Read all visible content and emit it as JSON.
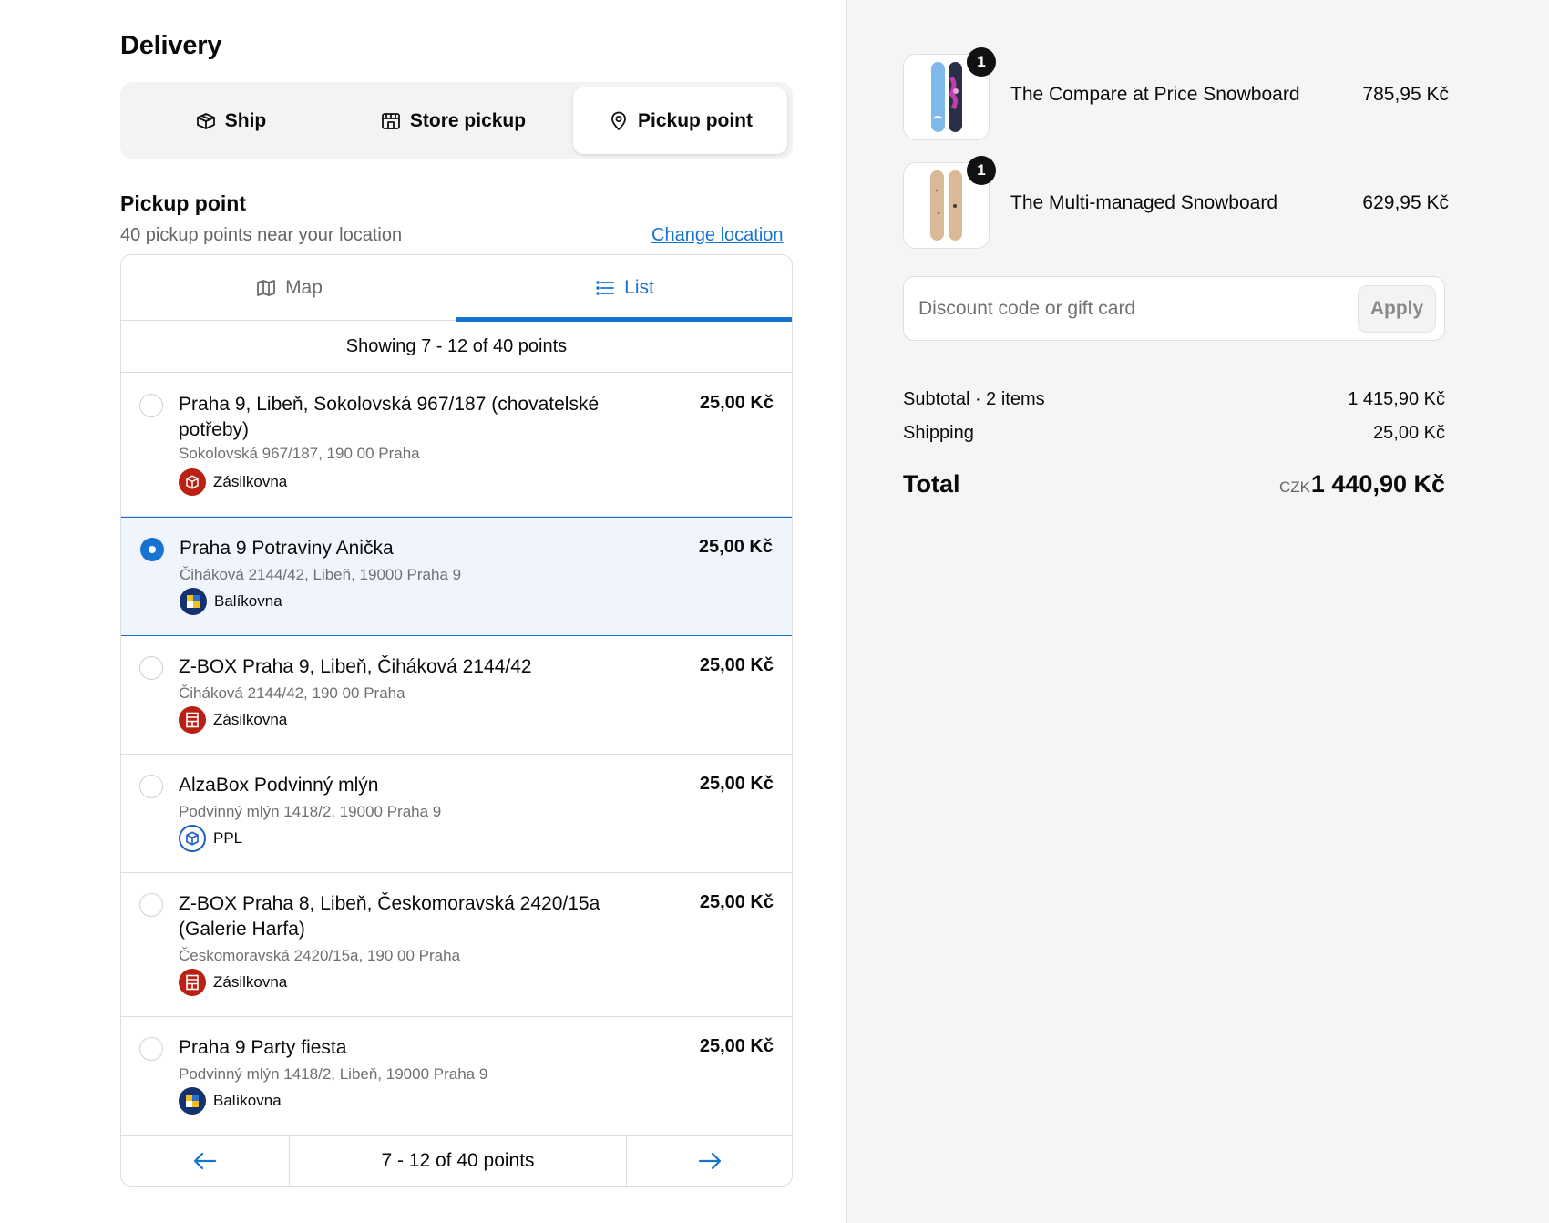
{
  "delivery": {
    "title": "Delivery",
    "methods": [
      {
        "label": "Ship"
      },
      {
        "label": "Store pickup"
      },
      {
        "label": "Pickup point"
      }
    ]
  },
  "pickup": {
    "title": "Pickup point",
    "near": "40 pickup points near your location",
    "change_location": "Change location",
    "tabs": {
      "map": "Map",
      "list": "List"
    },
    "showing": "Showing 7 - 12 of 40 points",
    "points": [
      {
        "name": "Praha 9, Libeň, Sokolovská 967/187 (chovatelské potřeby)",
        "address": "Sokolovská 967/187, 190 00 Praha",
        "carrier": "Zásilkovna",
        "price": "25,00 Kč"
      },
      {
        "name": "Praha 9 Potraviny Anička",
        "address": "Čiháková 2144/42, Libeň, 19000 Praha 9",
        "carrier": "Balíkovna",
        "price": "25,00 Kč"
      },
      {
        "name": "Z-BOX Praha 9, Libeň, Čiháková 2144/42",
        "address": "Čiháková 2144/42, 190 00 Praha",
        "carrier": "Zásilkovna",
        "price": "25,00 Kč"
      },
      {
        "name": "AlzaBox Podvinný mlýn",
        "address": "Podvinný mlýn 1418/2, 19000 Praha 9",
        "carrier": "PPL",
        "price": "25,00 Kč"
      },
      {
        "name": "Z-BOX Praha 8, Libeň, Českomoravská 2420/15a (Galerie Harfa)",
        "address": "Českomoravská 2420/15a, 190 00 Praha",
        "carrier": "Zásilkovna",
        "price": "25,00 Kč"
      },
      {
        "name": "Praha 9 Party fiesta",
        "address": "Podvinný mlýn 1418/2, Libeň, 19000 Praha 9",
        "carrier": "Balíkovna",
        "price": "25,00 Kč"
      }
    ],
    "pager_text": "7 - 12 of 40 points"
  },
  "summary": {
    "items": [
      {
        "title": "The Compare at Price Snowboard",
        "price": "785,95 Kč",
        "qty": "1"
      },
      {
        "title": "The Multi-managed Snowboard",
        "price": "629,95 Kč",
        "qty": "1"
      }
    ],
    "discount_placeholder": "Discount code or gift card",
    "apply_label": "Apply",
    "subtotal_label": "Subtotal · 2 items",
    "subtotal_value": "1 415,90 Kč",
    "shipping_label": "Shipping",
    "shipping_value": "25,00 Kč",
    "total_label": "Total",
    "total_currency": "CZK",
    "total_value": "1 440,90 Kč"
  },
  "colors": {
    "accent": "#1773d0",
    "zasilkovna": "#ba2114",
    "balikovna": "#14326e",
    "ppl": "#1d5ec4"
  }
}
